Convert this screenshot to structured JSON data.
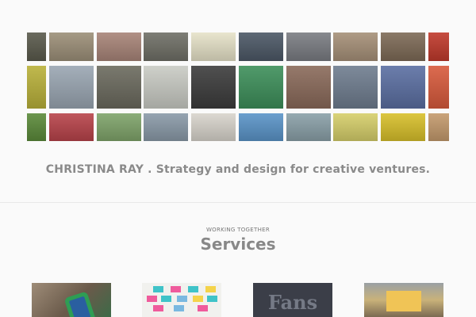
{
  "page": {
    "tagline": "CHRISTINA RAY . Strategy and design for creative ventures.",
    "background": "#fafafa"
  },
  "mosaic": {
    "tiles": [
      {
        "name": "photo-tile",
        "color": "#5a5a4c"
      },
      {
        "name": "photo-tile",
        "color": "#9c8f78"
      },
      {
        "name": "photo-tile",
        "color": "#a88478"
      },
      {
        "name": "photo-tile",
        "color": "#6f6f66"
      },
      {
        "name": "photo-tile",
        "color": "#e6e2c8"
      },
      {
        "name": "photo-tile",
        "color": "#4c5866"
      },
      {
        "name": "photo-tile",
        "color": "#7a7c82"
      },
      {
        "name": "photo-tile",
        "color": "#a69078"
      },
      {
        "name": "photo-tile",
        "color": "#7d6a56"
      },
      {
        "name": "photo-tile",
        "color": "#c0392b"
      },
      {
        "name": "photo-tile",
        "color": "#b9b13a"
      },
      {
        "name": "photo-tile",
        "color": "#9aa6b2"
      },
      {
        "name": "photo-tile",
        "color": "#6b6a5e"
      },
      {
        "name": "photo-tile",
        "color": "#c9cbc4"
      },
      {
        "name": "photo-tile",
        "color": "#3c3c3c"
      },
      {
        "name": "photo-tile",
        "color": "#3d8f5a"
      },
      {
        "name": "photo-tile",
        "color": "#8a6a5a"
      },
      {
        "name": "photo-tile",
        "color": "#6f7d8f"
      },
      {
        "name": "photo-tile",
        "color": "#5b6fa2"
      },
      {
        "name": "photo-tile",
        "color": "#d85a3c"
      },
      {
        "name": "photo-tile",
        "color": "#5b8a3a"
      },
      {
        "name": "photo-tile",
        "color": "#b8434a"
      },
      {
        "name": "photo-tile",
        "color": "#7fa46a"
      },
      {
        "name": "photo-tile",
        "color": "#8a9aa8"
      },
      {
        "name": "photo-tile",
        "color": "#d8d4cc"
      },
      {
        "name": "photo-tile",
        "color": "#5a94c8"
      },
      {
        "name": "photo-tile",
        "color": "#8aa0a8"
      },
      {
        "name": "photo-tile",
        "color": "#d6cf6a"
      },
      {
        "name": "photo-tile",
        "color": "#d8c02a"
      },
      {
        "name": "photo-tile",
        "color": "#c49a6c"
      }
    ]
  },
  "services": {
    "eyebrow": "WORKING TOGETHER",
    "title": "Services",
    "cards": [
      {
        "icon": "phone-photo"
      },
      {
        "icon": "sticky-notes-photo"
      },
      {
        "icon": "fans-sign-photo",
        "text": "Fans"
      },
      {
        "icon": "event-crowd-photo"
      }
    ]
  }
}
